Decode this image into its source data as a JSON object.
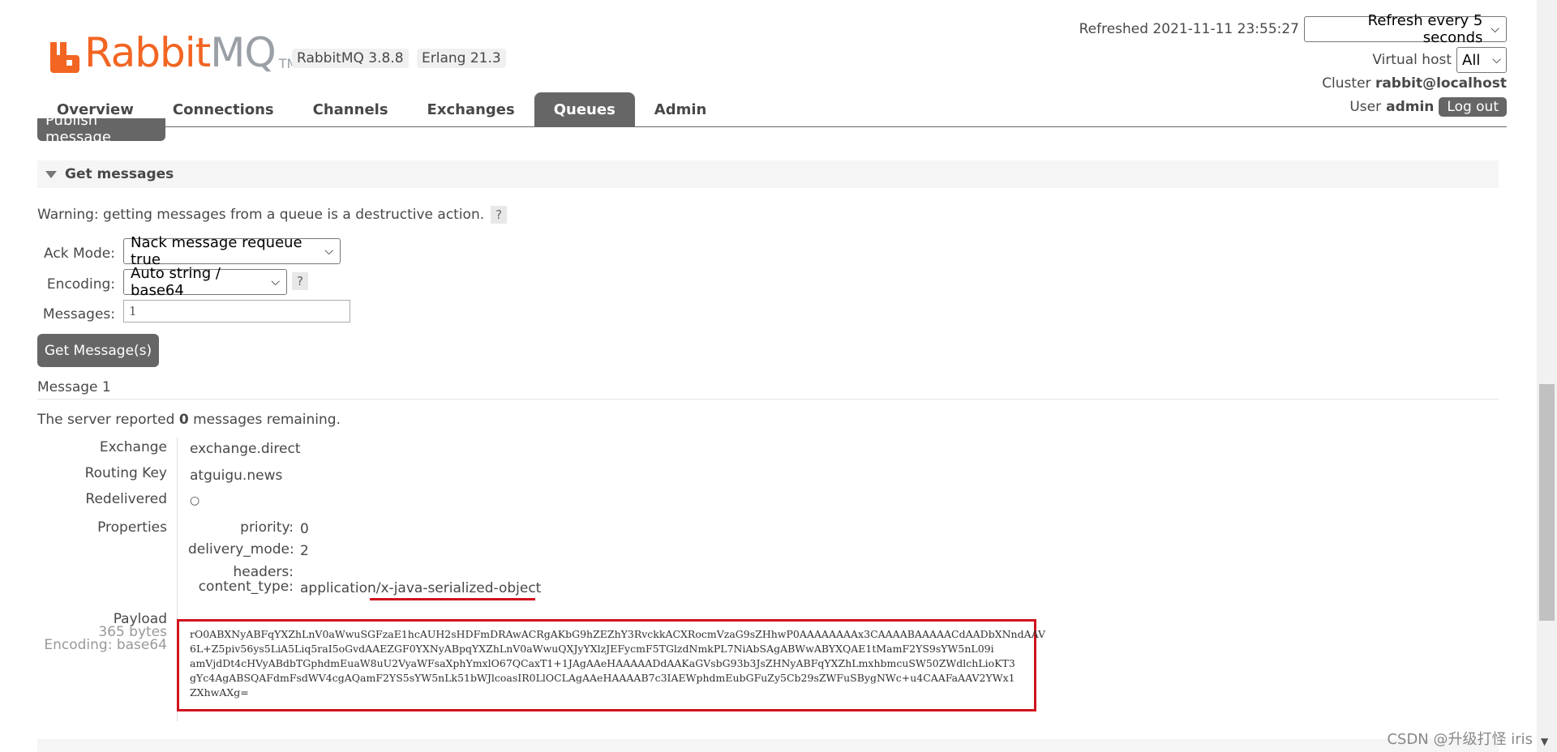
{
  "header": {
    "logo_rabbit": "Rabbit",
    "logo_mq": "MQ",
    "logo_tm": "TM",
    "version": "RabbitMQ 3.8.8",
    "erlang": "Erlang 21.3",
    "refreshed": "Refreshed 2021-11-11 23:55:27",
    "refresh_select": "Refresh every 5 seconds",
    "vhost_label": "Virtual host",
    "vhost_select": "All",
    "cluster_label": "Cluster",
    "cluster_value": "rabbit@localhost",
    "user_label": "User",
    "user_value": "admin",
    "logout": "Log out"
  },
  "tabs": [
    {
      "label": "Overview"
    },
    {
      "label": "Connections"
    },
    {
      "label": "Channels"
    },
    {
      "label": "Exchanges"
    },
    {
      "label": "Queues"
    },
    {
      "label": "Admin"
    }
  ],
  "publish_button": "Publish message",
  "get_messages": {
    "title": "Get messages",
    "warning": "Warning: getting messages from a queue is a destructive action.",
    "help": "?",
    "ack_mode_label": "Ack Mode:",
    "ack_mode_value": "Nack message requeue true",
    "encoding_label": "Encoding:",
    "encoding_value": "Auto string / base64",
    "messages_label": "Messages:",
    "messages_value": "1",
    "get_button": "Get Message(s)"
  },
  "message": {
    "title": "Message 1",
    "remaining_pre": "The server reported",
    "remaining_count": "0",
    "remaining_post": "messages remaining.",
    "exchange_label": "Exchange",
    "exchange_value": "exchange.direct",
    "routing_key_label": "Routing Key",
    "routing_key_value": "atguigu.news",
    "redelivered_label": "Redelivered",
    "redelivered_value": "○",
    "properties_label": "Properties",
    "priority_label": "priority:",
    "priority_value": "0",
    "delivery_mode_label": "delivery_mode:",
    "delivery_mode_value": "2",
    "headers_label": "headers:",
    "content_type_label": "content_type:",
    "content_type_value": "application/x-java-serialized-object",
    "payload_label": "Payload",
    "payload_bytes": "365 bytes",
    "payload_encoding": "Encoding: base64",
    "payload_lines": [
      "rO0ABXNyABFqYXZhLnV0aWwuSGFzaE1hcAUH2sHDFmDRAwACRgAKbG9hZEZhY3RvckkACXRocmVzaG9sZHhwP0AAAAAAAAx3CAAAABAAAAACdAADbXNndAAV",
      "6L+Z5piv56ys5LiA5Liq5raI5oGvdAAEZGF0YXNyABpqYXZhLnV0aWwuQXJyYXlzJEFycmF5TGlzdNmkPL7NiAbSAgABWwABYXQAE1tMamF2YS9sYW5nL09i",
      "amVjdDt4cHVyABdbTGphdmEuaW8uU2VyaWFsaXphYmxlO67QCaxT1+1JAgAAeHAAAAADdAAKaGVsbG93b3JsZHNyABFqYXZhLmxhbmcuSW50ZWdlchLioKT3",
      "gYc4AgABSQAFdmFsdWV4cgAQamF2YS5sYW5nLk51bWJlcoasIR0LlOCLAgAAeHAAAAB7c3IAEWphdmEubGFuZy5Cb29sZWFuSBygNWc+u4CAAFaAAV2YWx1",
      "ZXhwAXg="
    ]
  },
  "watermark": "CSDN @升级打怪 iris"
}
